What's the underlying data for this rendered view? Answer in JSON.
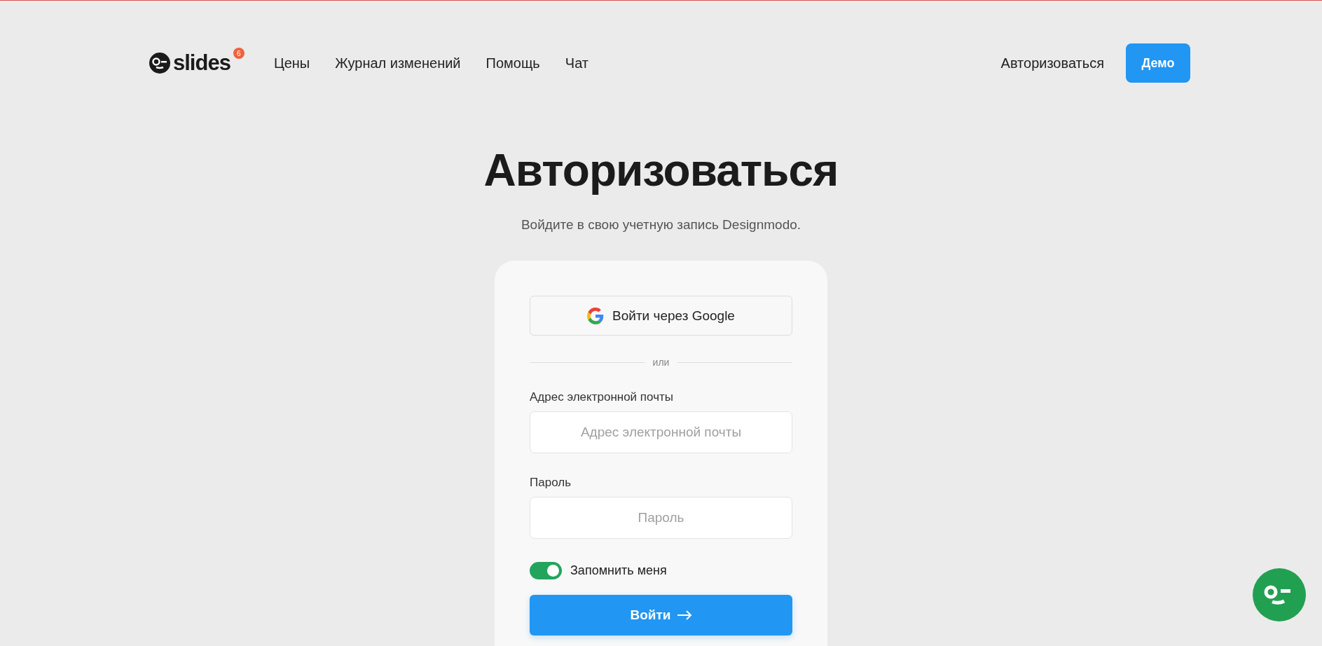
{
  "header": {
    "logo": {
      "text": "slides",
      "badge": "6"
    },
    "nav": [
      {
        "label": "Цены"
      },
      {
        "label": "Журнал изменений"
      },
      {
        "label": "Помощь"
      },
      {
        "label": "Чат"
      }
    ],
    "login_link": "Авторизоваться",
    "demo_button": "Демо"
  },
  "title": "Авторизоваться",
  "subtitle": "Войдите в свою учетную запись Designmodo.",
  "form": {
    "google_button": "Войти через Google",
    "divider": "или",
    "fields": [
      {
        "label": "Адрес электронной почты",
        "placeholder": "Адрес электронной почты"
      },
      {
        "label": "Пароль",
        "placeholder": "Пароль"
      }
    ],
    "remember": {
      "label": "Запомнить меня",
      "on": true
    },
    "submit": "Войти"
  }
}
